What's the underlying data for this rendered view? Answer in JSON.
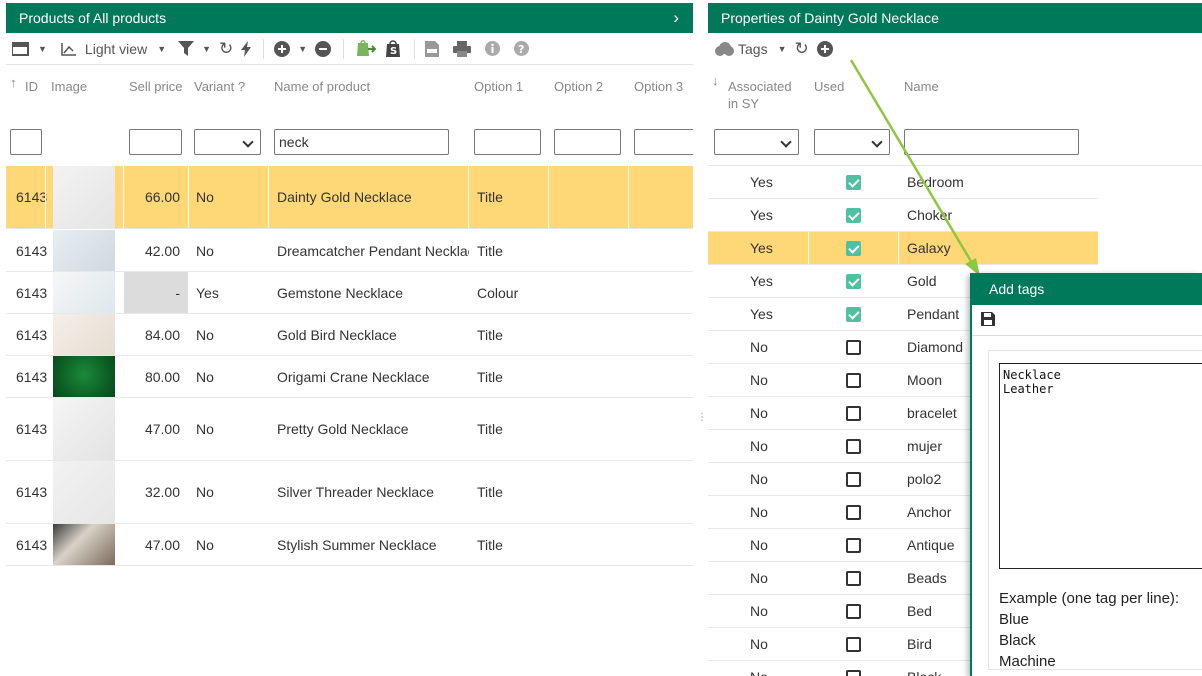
{
  "left": {
    "title": "Products of All products",
    "toolbar": {
      "view_label": "Light view"
    },
    "columns": [
      "ID",
      "Image",
      "Sell price",
      "Variant ?",
      "Name of product",
      "Option 1",
      "Option 2",
      "Option 3"
    ],
    "filter_name": "neck",
    "rows": [
      {
        "id": "6143",
        "price": "66.00",
        "variant": "No",
        "name": "Dainty Gold Necklace",
        "opt1": "Title"
      },
      {
        "id": "6143",
        "price": "42.00",
        "variant": "No",
        "name": "Dreamcatcher Pendant Necklace",
        "opt1": "Title"
      },
      {
        "id": "6143",
        "price": "-",
        "variant": "Yes",
        "name": "Gemstone Necklace",
        "opt1": "Colour"
      },
      {
        "id": "6143",
        "price": "84.00",
        "variant": "No",
        "name": "Gold Bird Necklace",
        "opt1": "Title"
      },
      {
        "id": "6143",
        "price": "80.00",
        "variant": "No",
        "name": "Origami Crane Necklace",
        "opt1": "Title"
      },
      {
        "id": "6143",
        "price": "47.00",
        "variant": "No",
        "name": "Pretty Gold Necklace",
        "opt1": "Title"
      },
      {
        "id": "6143",
        "price": "32.00",
        "variant": "No",
        "name": "Silver Threader Necklace",
        "opt1": "Title"
      },
      {
        "id": "6143",
        "price": "47.00",
        "variant": "No",
        "name": "Stylish Summer Necklace",
        "opt1": "Title"
      }
    ]
  },
  "right": {
    "title": "Properties of Dainty Gold Necklace",
    "toolbar": {
      "tags_label": "Tags"
    },
    "columns": {
      "assoc_1": "Associated",
      "assoc_2": "in SY",
      "used": "Used",
      "name": "Name"
    },
    "rows": [
      {
        "assoc": "Yes",
        "used": true,
        "name": "Bedroom"
      },
      {
        "assoc": "Yes",
        "used": true,
        "name": "Choker"
      },
      {
        "assoc": "Yes",
        "used": true,
        "name": "Galaxy"
      },
      {
        "assoc": "Yes",
        "used": true,
        "name": "Gold"
      },
      {
        "assoc": "Yes",
        "used": true,
        "name": "Pendant"
      },
      {
        "assoc": "No",
        "used": false,
        "name": "Diamond"
      },
      {
        "assoc": "No",
        "used": false,
        "name": "Moon"
      },
      {
        "assoc": "No",
        "used": false,
        "name": "bracelet"
      },
      {
        "assoc": "No",
        "used": false,
        "name": "mujer"
      },
      {
        "assoc": "No",
        "used": false,
        "name": "polo2"
      },
      {
        "assoc": "No",
        "used": false,
        "name": "Anchor"
      },
      {
        "assoc": "No",
        "used": false,
        "name": "Antique"
      },
      {
        "assoc": "No",
        "used": false,
        "name": "Beads"
      },
      {
        "assoc": "No",
        "used": false,
        "name": "Bed"
      },
      {
        "assoc": "No",
        "used": false,
        "name": "Bird"
      },
      {
        "assoc": "No",
        "used": false,
        "name": "Black"
      }
    ]
  },
  "dialog": {
    "title": "Add tags",
    "textarea": "Necklace\nLeather",
    "example_title": "Example (one tag per line):",
    "examples": [
      "Blue",
      "Black",
      "Machine"
    ]
  },
  "colors": {
    "header": "#00795a",
    "highlight": "#fed876",
    "check": "#4fc1a2",
    "arrow": "#8dc63f"
  }
}
